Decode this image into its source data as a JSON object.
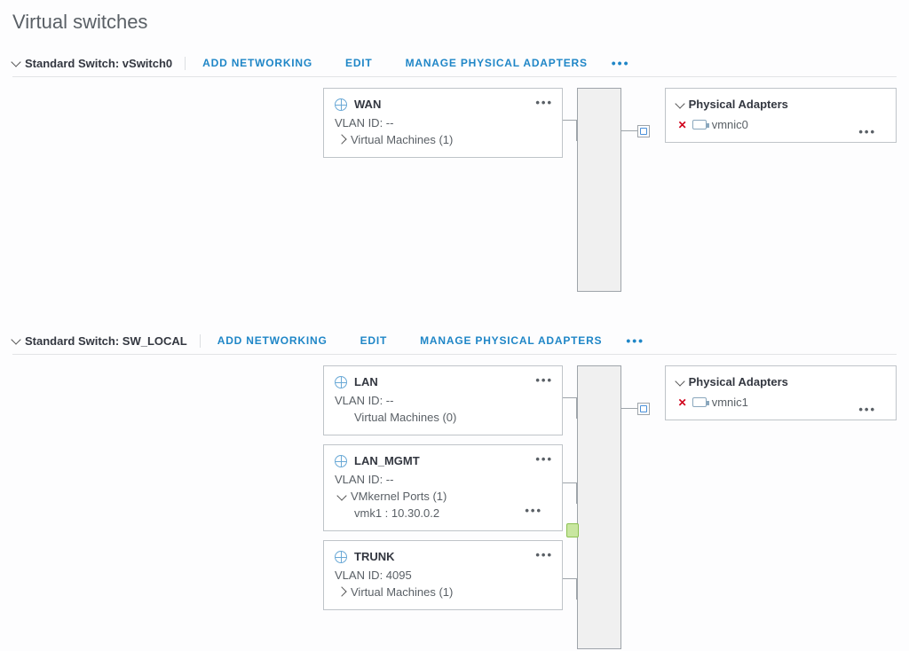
{
  "page_title": "Virtual switches",
  "switches": [
    {
      "title": "Standard Switch: vSwitch0",
      "actions": {
        "add": "Add Networking",
        "edit": "Edit",
        "manage": "Manage Physical Adapters"
      },
      "physical_adapters_label": "Physical Adapters",
      "adapters": [
        {
          "name": "vmnic0",
          "down": true
        }
      ],
      "portgroups": [
        {
          "name": "WAN",
          "vlan_label": "VLAN ID: --",
          "expand_vm": true,
          "vm_label": "Virtual Machines (1)"
        }
      ]
    },
    {
      "title": "Standard Switch: SW_LOCAL",
      "actions": {
        "add": "Add Networking",
        "edit": "Edit",
        "manage": "Manage Physical Adapters"
      },
      "physical_adapters_label": "Physical Adapters",
      "adapters": [
        {
          "name": "vmnic1",
          "down": true
        }
      ],
      "portgroups": [
        {
          "name": "LAN",
          "vlan_label": "VLAN ID: --",
          "expand_vm": false,
          "vm_label": "Virtual Machines (0)"
        },
        {
          "name": "LAN_MGMT",
          "vlan_label": "VLAN ID: --",
          "vmk_label": "VMkernel Ports (1)",
          "vmk_item": "vmk1 : 10.30.0.2"
        },
        {
          "name": "TRUNK",
          "vlan_label": "VLAN ID: 4095",
          "expand_vm": true,
          "vm_label": "Virtual Machines (1)"
        }
      ]
    }
  ]
}
